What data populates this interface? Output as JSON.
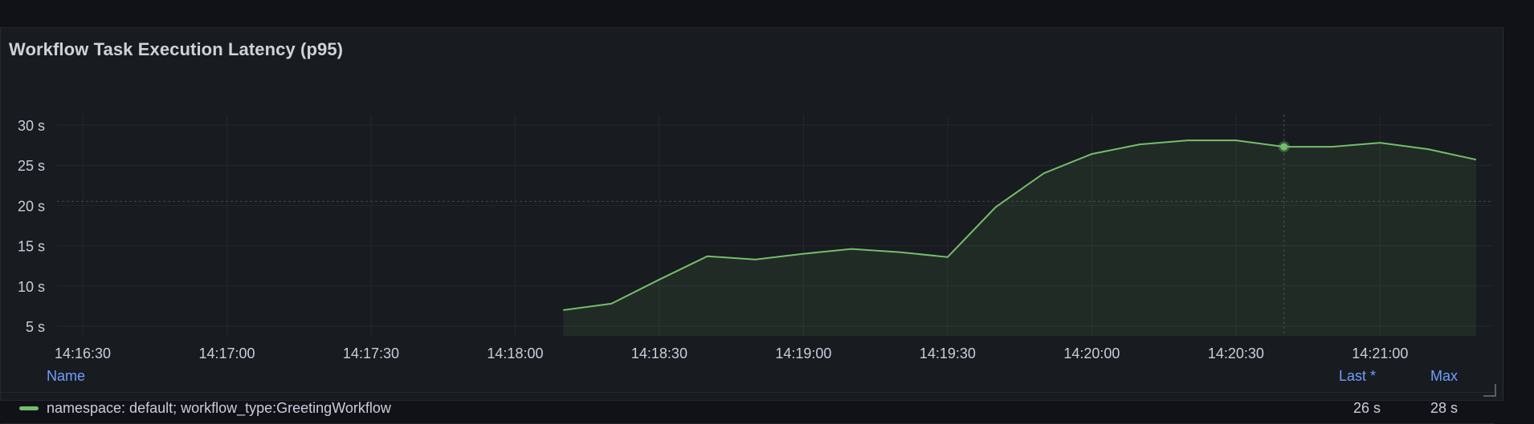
{
  "panel": {
    "title": "Workflow Task Execution Latency (p95)"
  },
  "chart_data": {
    "type": "area",
    "title": "Workflow Task Execution Latency (p95)",
    "y_tick_labels": [
      "30 s",
      "25 s",
      "20 s",
      "15 s",
      "10 s",
      "5 s"
    ],
    "y_ticks": [
      30,
      25,
      20,
      15,
      10,
      5
    ],
    "ylim": [
      3,
      31.5
    ],
    "x_tick_labels": [
      "14:16:30",
      "14:17:00",
      "14:17:30",
      "14:18:00",
      "14:18:30",
      "14:19:00",
      "14:19:30",
      "14:20:00",
      "14:20:30",
      "14:21:00"
    ],
    "x_ticks": [
      "14:16:30",
      "14:17:00",
      "14:17:30",
      "14:18:00",
      "14:18:30",
      "14:19:00",
      "14:19:30",
      "14:20:00",
      "14:20:30",
      "14:21:00"
    ],
    "xlim": [
      "14:16:30",
      "14:21:20"
    ],
    "grid": true,
    "threshold_line": 20.5,
    "hover_time": "14:20:40",
    "series": [
      {
        "name": "namespace: default; workflow_type:GreetingWorkflow",
        "color": "#73bf69",
        "x": [
          "14:18:10",
          "14:18:20",
          "14:18:30",
          "14:18:40",
          "14:18:50",
          "14:19:00",
          "14:19:10",
          "14:19:20",
          "14:19:30",
          "14:19:40",
          "14:19:50",
          "14:20:00",
          "14:20:10",
          "14:20:20",
          "14:20:30",
          "14:20:40",
          "14:20:50",
          "14:21:00",
          "14:21:10",
          "14:21:20"
        ],
        "values": [
          7.0,
          7.8,
          10.8,
          13.7,
          13.3,
          14.0,
          14.6,
          14.2,
          13.6,
          19.8,
          24.0,
          26.4,
          27.6,
          28.1,
          28.1,
          27.3,
          27.3,
          27.8,
          27.0,
          25.7
        ]
      }
    ]
  },
  "legend": {
    "name_header": "Name",
    "last_header": "Last *",
    "max_header": "Max",
    "rows": [
      {
        "name": "namespace: default; workflow_type:GreetingWorkflow",
        "last": "26 s",
        "max": "28 s",
        "color": "#73bf69"
      }
    ]
  }
}
